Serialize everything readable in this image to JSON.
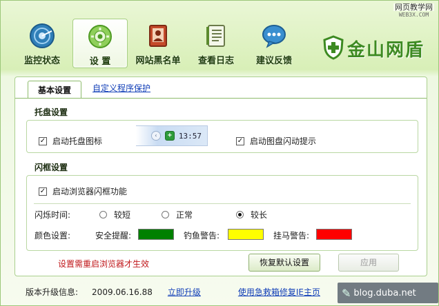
{
  "watermark": {
    "line1": "网页教学网",
    "line2": "WEB3X.COM"
  },
  "window_controls": [
    "min-icon",
    "close-icon"
  ],
  "toolbar": {
    "items": [
      {
        "label": "监控状态",
        "icon": "radar-icon"
      },
      {
        "label": "设  置",
        "icon": "gear-icon",
        "active": true
      },
      {
        "label": "网站黑名单",
        "icon": "blacklist-icon"
      },
      {
        "label": "查看日志",
        "icon": "log-icon"
      },
      {
        "label": "建议反馈",
        "icon": "chat-bubble-icon"
      }
    ]
  },
  "brand": {
    "name": "金山网盾",
    "icon": "shield-icon"
  },
  "tabs": {
    "main": "基本设置",
    "secondary": "自定义程序保护"
  },
  "tray_section": {
    "title": "托盘设置",
    "show_tray_icon": {
      "label": "启动托盘图标",
      "checked": true
    },
    "tray_time": "13:57",
    "tray_flash": {
      "label": "启动图盘闪动提示",
      "checked": true
    }
  },
  "flash_section": {
    "title": "闪框设置",
    "browser_flash": {
      "label": "启动浏览器闪框功能",
      "checked": true
    },
    "time_label": "闪烁时间:",
    "time_options": [
      {
        "label": "较短",
        "selected": false
      },
      {
        "label": "正常",
        "selected": false
      },
      {
        "label": "较长",
        "selected": true
      }
    ],
    "color_label": "颜色设置:",
    "colors": [
      {
        "label": "安全提醒:",
        "color": "#008000"
      },
      {
        "label": "钓鱼警告:",
        "color": "#ffff00"
      },
      {
        "label": "挂马警告:",
        "color": "#ff0000"
      }
    ]
  },
  "note": "设置需重启浏览器才生效",
  "buttons": {
    "restore_default": "恢复默认设置",
    "apply": "应用"
  },
  "footer": {
    "label": "版本升级信息:",
    "version": "2009.06.16.88",
    "upgrade_link": "立即升级",
    "repair_link": "使用急救箱修复IE主页"
  },
  "blog_badge": "blog.duba.net"
}
